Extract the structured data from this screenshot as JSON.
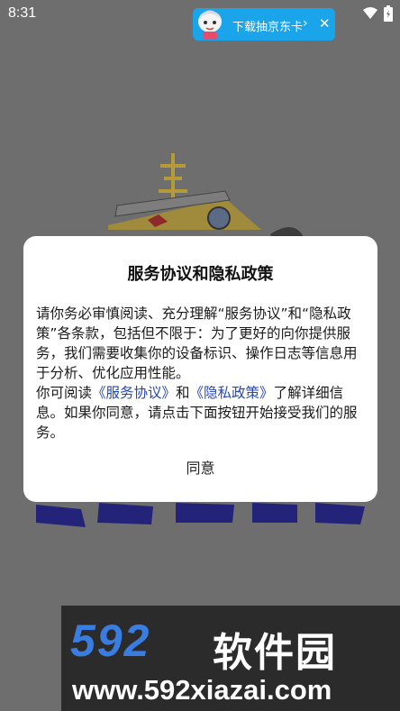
{
  "status_bar": {
    "time": "8:31"
  },
  "promo": {
    "text": "下载抽京东卡",
    "chevron": "›",
    "close": "✕"
  },
  "dialog": {
    "title": "服务协议和隐私政策",
    "paragraph1": "请你务必审慎阅读、充分理解“服务协议”和“隐私政策”各条款，包括但不限于：为了更好的向你提供服务，我们需要收集你的设备标识、操作日志等信息用于分析、优化应用性能。",
    "p2_prefix": "你可阅读",
    "service_link": "《服务协议》",
    "p2_and": "和",
    "privacy_link": "《隐私政策》",
    "p2_suffix": "了解详细信息。如果你同意，请点击下面按钮开始接受我们的服务。",
    "agree_label": "同意"
  },
  "watermark": {
    "number": "592",
    "cn": "软件园",
    "url": "www.592xiazai.com"
  },
  "colors": {
    "overlay": "#6e6e6e",
    "dialog_bg": "#ffffff",
    "link": "#2446b8",
    "promo_bg": "#1aa4ea",
    "watermark_blue": "#3a7de0"
  }
}
